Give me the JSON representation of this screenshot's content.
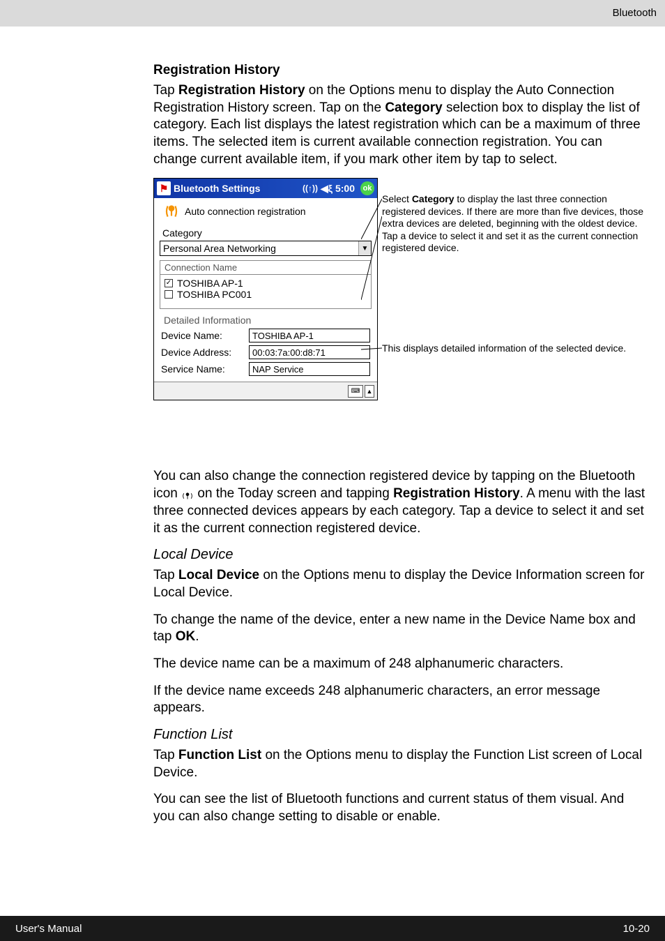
{
  "header": {
    "section": "Bluetooth"
  },
  "section1": {
    "heading": "Registration History",
    "para1a": "Tap ",
    "para1b": "Registration History",
    "para1c": " on the Options menu to display the Auto Connection Registration History screen. Tap on the ",
    "para1d": "Category",
    "para1e": " selection box to display the list of category. Each list displays the latest registration which can be a maximum of three items. The selected item is current available connection registration. You can change current available item, if you mark other item by tap to select."
  },
  "device": {
    "title": "Bluetooth Settings",
    "time": "5:00",
    "ok": "ok",
    "subtitle": "Auto connection registration",
    "category_label": "Category",
    "category_value": "Personal Area Networking",
    "list_header": "Connection Name",
    "items": [
      {
        "checked": true,
        "label": "TOSHIBA AP-1"
      },
      {
        "checked": false,
        "label": "TOSHIBA PC001"
      }
    ],
    "detail_label": "Detailed Information",
    "fields": [
      {
        "k": "Device Name:",
        "v": "TOSHIBA AP-1"
      },
      {
        "k": "Device Address:",
        "v": "00:03:7a:00:d8:71"
      },
      {
        "k": "Service Name:",
        "v": "NAP Service"
      }
    ]
  },
  "callouts": {
    "c1a": "Select ",
    "c1b": "Category",
    "c1c": " to display the last three connection registered devices. If there are more than five devices, those extra devices are deleted, beginning with the oldest device. Tap a device to select it and set it as the current connection registered device.",
    "c2": "This displays detailed information of the selected device."
  },
  "section2": {
    "p1a": "You can also change the connection registered device by tapping on the Bluetooth icon ",
    "p1b": " on the Today screen and tapping ",
    "p1c": "Registration History",
    "p1d": ". A menu with the last three connected devices appears by each category. Tap a device to select it and set it as the current connection registered device."
  },
  "section3": {
    "heading": "Local Device",
    "p1a": "Tap ",
    "p1b": "Local Device",
    "p1c": " on the Options menu to display the Device Information screen for Local Device.",
    "p2a": "To change the name of the device, enter a new name in the Device Name box and tap ",
    "p2b": "OK",
    "p2c": ".",
    "p3": "The device name can be a maximum of 248 alphanumeric characters.",
    "p4": "If the device name exceeds 248 alphanumeric characters, an error message appears."
  },
  "section4": {
    "heading": "Function List",
    "p1a": "Tap ",
    "p1b": "Function List",
    "p1c": " on the Options menu to display the Function List screen of Local Device.",
    "p2": "You can see the list of Bluetooth functions and current status of them visual. And you can also change setting to disable or enable."
  },
  "footer": {
    "left": "User's Manual",
    "right": "10-20"
  }
}
